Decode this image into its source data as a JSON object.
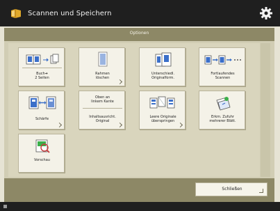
{
  "header": {
    "title": "Scannen und Speichern",
    "app_icon": "folder-icon",
    "settings_icon": "gear-icon"
  },
  "subheader": {
    "label": "Optionen"
  },
  "tiles": [
    {
      "label": "Buch➔\n2 Seiten",
      "icon": "book-to-two-pages-icon"
    },
    {
      "label": "Rahmen\nlöschen",
      "icon": "erase-frame-icon"
    },
    {
      "label": "Unterschiedl.\nOriginalform.",
      "icon": "different-size-originals-icon"
    },
    {
      "label": "Fortlaufendes\nScannen",
      "icon": "job-build-icon"
    },
    {
      "label": "Schärfe",
      "icon": "sharpness-icon"
    },
    {
      "top": "Oben an\nlinkem Kante",
      "label": "Inhaltsausricht.\nOriginal",
      "icon": "original-orientation-icon"
    },
    {
      "label": "Leere Originale\nüberspringen",
      "icon": "skip-blank-originals-icon"
    },
    {
      "label": "Erkm. Zufuhr\nmehrerer Blätt.",
      "icon": "double-feed-detect-icon"
    },
    {
      "label": "Vorschau",
      "icon": "preview-icon"
    }
  ],
  "footer": {
    "close_label": "Schließen"
  },
  "colors": {
    "header_bg": "#1f1f1f",
    "accent": "#8d8866",
    "panel": "#d1cdb4",
    "tile": "#f4f2e8",
    "icon_blue": "#3b6fc9"
  }
}
